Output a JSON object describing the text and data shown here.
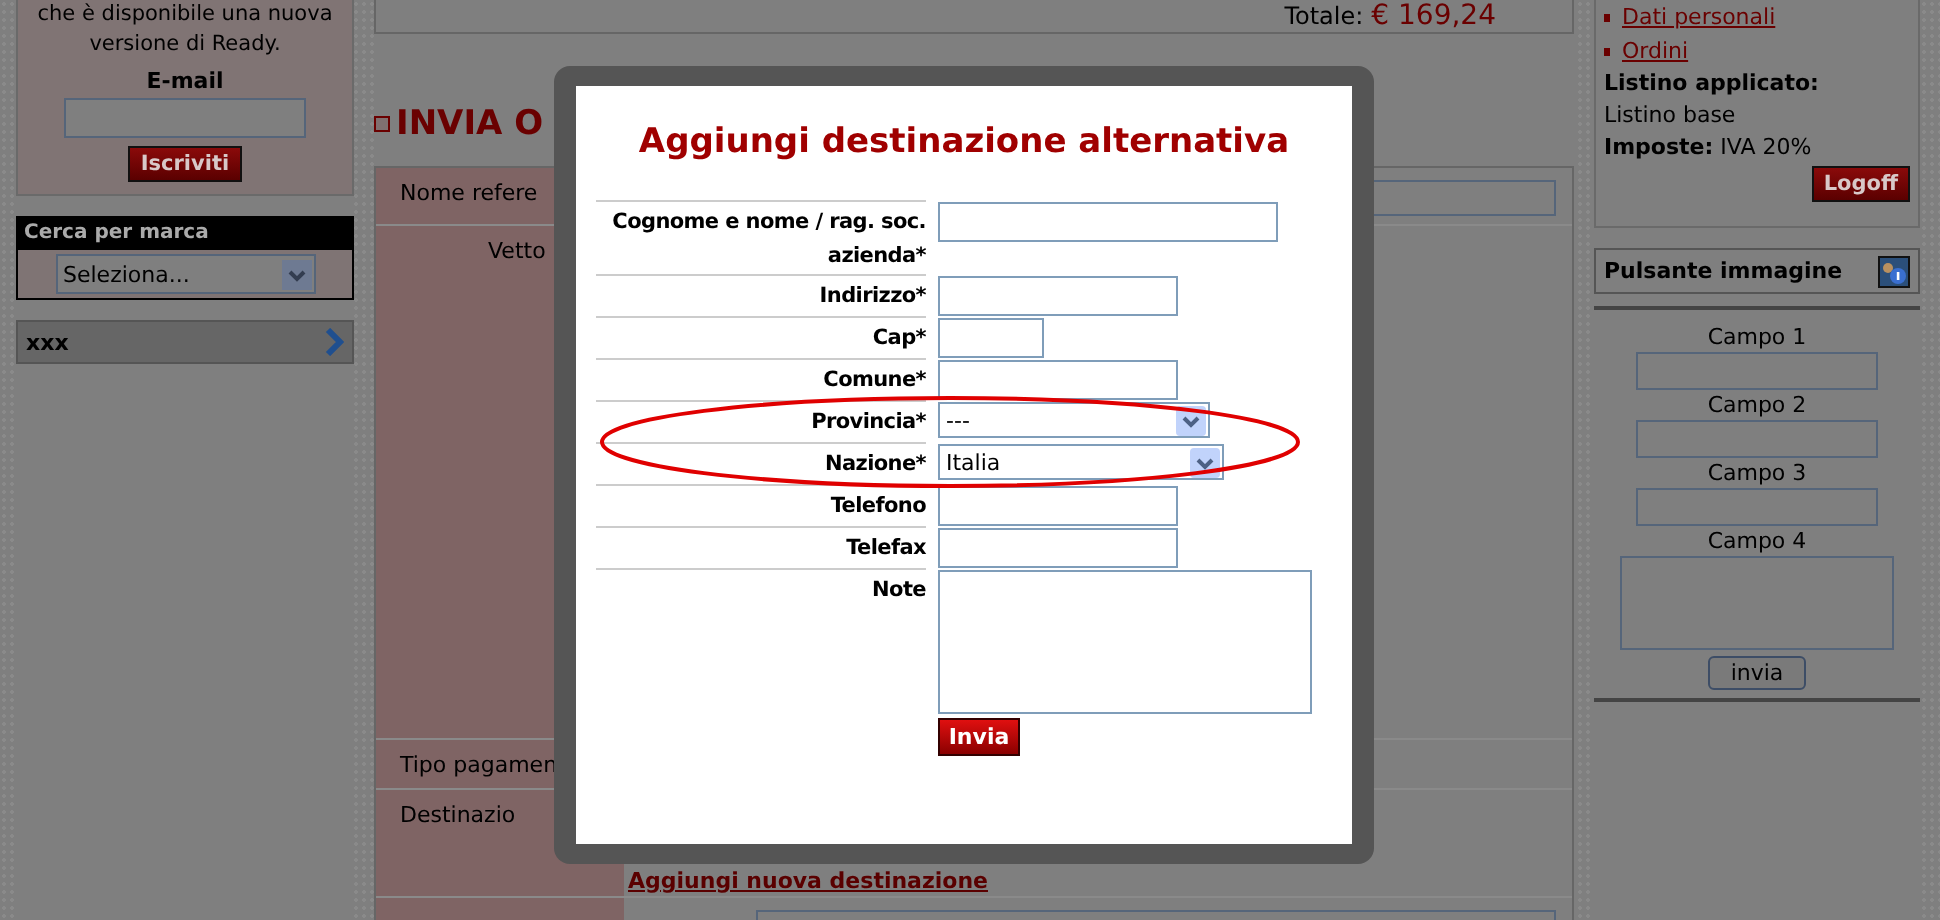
{
  "left_sidebar": {
    "newsletter_lines": [
      "che è disponibile una nuova",
      "versione di Ready."
    ],
    "email_label": "E-mail",
    "subscribe_button": "Iscriviti",
    "brand_search": {
      "title": "Cerca per marca",
      "select_value": "Seleziona..."
    },
    "menu_item": "xxx"
  },
  "main": {
    "total_label": "Totale:",
    "total_value": "€ 169,24",
    "heading": "INVIA O",
    "rows": [
      {
        "label": "Nome refere",
        "kind": "field"
      },
      {
        "label": "Vetto",
        "kind": "tall"
      },
      {
        "label": "Tipo pagamen",
        "kind": "plain"
      },
      {
        "label": "Destinazio",
        "kind": "link",
        "link": "Aggiungi nuova destinazione"
      },
      {
        "kind": "field"
      }
    ]
  },
  "right_sidebar": {
    "links": [
      "Dati personali",
      "Ordini"
    ],
    "price_list_label": "Listino applicato:",
    "price_list_value": "Listino base",
    "tax_label": "Imposte:",
    "tax_value": "IVA 20%",
    "logoff_button": "Logoff",
    "image_button_box": {
      "title": "Pulsante immagine",
      "fields": [
        {
          "label": "Campo 1",
          "kind": "input"
        },
        {
          "label": "Campo 2",
          "kind": "input"
        },
        {
          "label": "Campo 3",
          "kind": "input"
        },
        {
          "label": "Campo 4",
          "kind": "textarea"
        }
      ],
      "submit_button": "invia"
    }
  },
  "modal": {
    "title": "Aggiungi destinazione alternativa",
    "fields": [
      {
        "label": "Cognome e nome / rag. soc. azienda*",
        "kind": "long"
      },
      {
        "label": "Indirizzo*",
        "kind": "medium"
      },
      {
        "label": "Cap*",
        "kind": "short"
      },
      {
        "label": "Comune*",
        "kind": "medium"
      },
      {
        "label": "Provincia*",
        "kind": "select",
        "value": "---"
      },
      {
        "label": "Nazione*",
        "kind": "select-wide",
        "value": "Italia"
      },
      {
        "label": "Telefono",
        "kind": "medium"
      },
      {
        "label": "Telefax",
        "kind": "medium"
      },
      {
        "label": "Note",
        "kind": "textarea"
      }
    ],
    "submit_button": "Invia"
  }
}
